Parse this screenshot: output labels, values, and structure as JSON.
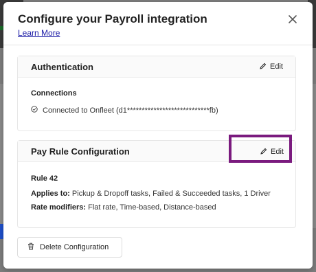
{
  "dialog": {
    "title": "Configure your Payroll integration",
    "learn_more": "Learn More",
    "close_icon": "close-icon"
  },
  "authentication": {
    "title": "Authentication",
    "edit_label": "Edit",
    "connections_label": "Connections",
    "connection_text": "Connected to Onfleet (d1****************************fb)"
  },
  "pay_rule": {
    "title": "Pay Rule Configuration",
    "edit_label": "Edit",
    "rule_name": "Rule 42",
    "applies_label": "Applies to:",
    "applies_value": " Pickup & Dropoff tasks, Failed & Succeeded tasks, 1 Driver",
    "modifiers_label": "Rate modifiers:",
    "modifiers_value": " Flat rate, Time-based, Distance-based"
  },
  "footer": {
    "delete_label": "Delete Configuration"
  },
  "colors": {
    "highlight": "#7a1a7e",
    "link": "#1a1aa6"
  }
}
